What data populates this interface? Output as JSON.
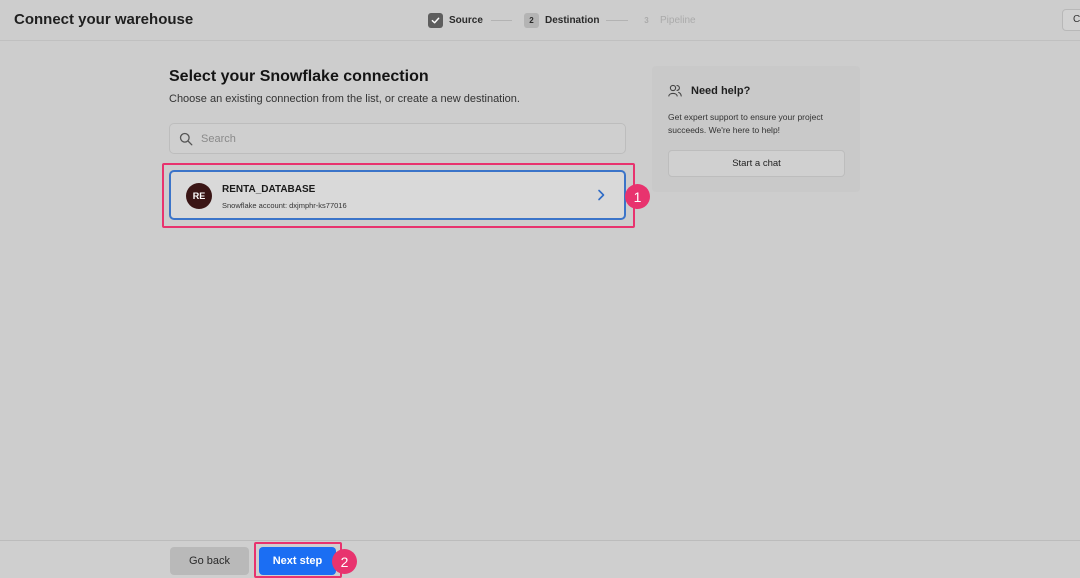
{
  "header": {
    "title": "Connect your warehouse",
    "right_button_label": "C"
  },
  "stepper": {
    "steps": [
      {
        "number": "",
        "label": "Source",
        "state": "done",
        "icon": "check-icon"
      },
      {
        "number": "2",
        "label": "Destination",
        "state": "active"
      },
      {
        "number": "3",
        "label": "Pipeline",
        "state": "pending"
      }
    ]
  },
  "main": {
    "title": "Select your Snowflake connection",
    "subtitle": "Choose an existing connection from the list, or create a new destination.",
    "search": {
      "placeholder": "Search",
      "value": "",
      "icon": "search-icon"
    },
    "connections": [
      {
        "avatar_text": "RE",
        "avatar_color": "#3a1515",
        "name": "RENTA_DATABASE",
        "account": "Snowflake account: dxjmphr-ks77016",
        "icon": "chevron-right-icon",
        "border_color": "#3b74c9"
      }
    ]
  },
  "help": {
    "icon": "users-icon",
    "title": "Need help?",
    "text": "Get expert support to ensure your project succeeds. We're here to help!",
    "button_label": "Start a chat"
  },
  "footer": {
    "back_label": "Go back",
    "next_label": "Next step",
    "next_color": "#1b6ef3"
  },
  "annotations": {
    "color": "#e8336e",
    "markers": [
      "1",
      "2"
    ]
  }
}
